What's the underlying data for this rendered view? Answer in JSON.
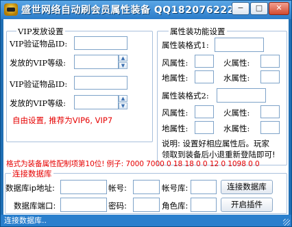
{
  "window": {
    "title": "盛世网络自动刷会员属性装备 QQ182076222",
    "min_label": "−",
    "max_label": "□",
    "close_label": "✕"
  },
  "vip": {
    "legend": "VIP发放设置",
    "id_label_1": "VIP验证物品ID:",
    "level_label_1": "发放的VIP等级:",
    "id_label_2": "VIP验证物品ID:",
    "level_label_2": "发放的VIP等级:",
    "hint": "自由设置, 推荐为VIP6, VIP7",
    "id_value_1": "",
    "level_value_1": "",
    "id_value_2": "",
    "level_value_2": ""
  },
  "attr": {
    "legend": "属性装功能设置",
    "format1_label": "属性装格式1:",
    "format2_label": "属性装格式2:",
    "wind": "风属性:",
    "fire": "火属性:",
    "earth": "地属性:",
    "water": "水属性:",
    "note_line1": "说明: 设置好相应属性后。玩家",
    "note_line2": "领取到装备后小退重新登陆即可!"
  },
  "format_hint": "格式为装备属性配制项第10位! 例子: 7000 7000 0 18 18 0 0 12 0 1098 0 0",
  "db": {
    "legend": "连接数据库",
    "ip_label": "数据库ip地址:",
    "port_label": "数据库端口:",
    "account_label": "帐号:",
    "password_label": "密码:",
    "account_db_label": "帐号库:",
    "role_db_label": "角色库:",
    "connect_button": "连接数据库",
    "start_button": "开启插件"
  },
  "status": {
    "text": "连接数据库.."
  },
  "icons": {
    "spin_up": "▲",
    "spin_down": "▼"
  }
}
